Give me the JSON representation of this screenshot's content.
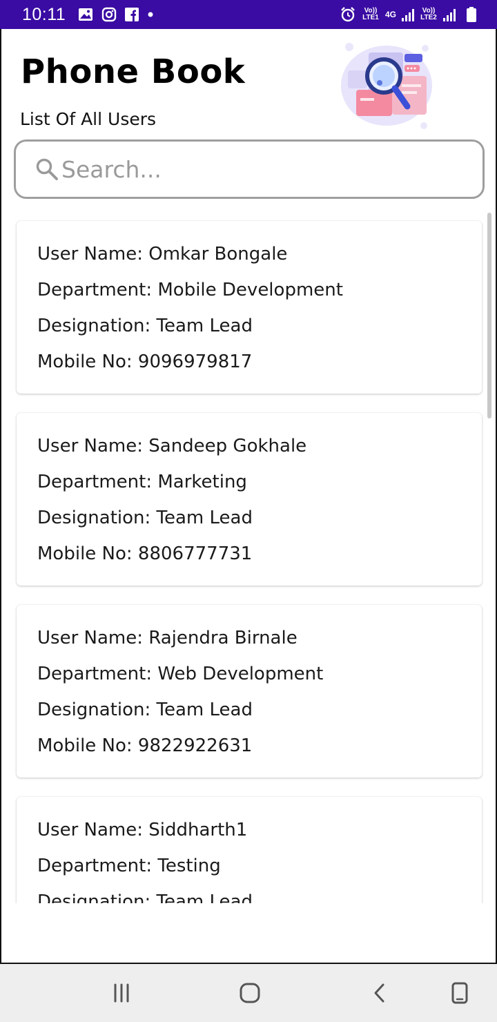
{
  "status_bar": {
    "time": "10:11",
    "net1": "Vo)) LTE1",
    "net_type": "4G",
    "net2": "Vo)) LTE2",
    "icons": [
      "gallery-icon",
      "instagram-icon",
      "facebook-icon",
      "dot-icon",
      "alarm-icon",
      "signal-icon",
      "battery-icon"
    ]
  },
  "header": {
    "title": "Phone Book",
    "subtitle": "List Of All Users"
  },
  "search": {
    "placeholder": "Search..."
  },
  "users": [
    {
      "name_line": "User Name: Omkar Bongale",
      "department_line": "Department: Mobile Development",
      "designation_line": "Designation: Team Lead",
      "mobile_line": "Mobile No: 9096979817"
    },
    {
      "name_line": "User Name: Sandeep Gokhale",
      "department_line": "Department: Marketing",
      "designation_line": "Designation: Team Lead",
      "mobile_line": "Mobile No: 8806777731"
    },
    {
      "name_line": "User Name: Rajendra Birnale",
      "department_line": "Department: Web Development",
      "designation_line": "Designation: Team Lead",
      "mobile_line": "Mobile No: 9822922631"
    },
    {
      "name_line": "User Name: Siddharth1",
      "department_line": "Department: Testing",
      "designation_line": "Designation: Team Lead"
    }
  ],
  "nav": {
    "buttons": [
      "recent-apps-icon",
      "home-icon",
      "back-icon",
      "rotate-icon"
    ]
  },
  "colors": {
    "status_bar": "#3a0ca3",
    "search_border": "#9e9e9e",
    "nav_bar": "#eeeeee"
  }
}
